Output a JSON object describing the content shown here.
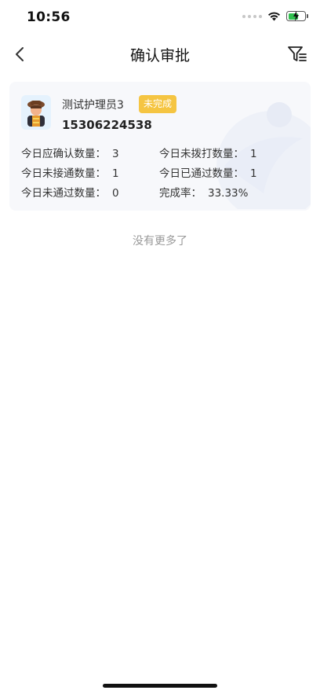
{
  "status_bar": {
    "time": "10:56"
  },
  "nav": {
    "title": "确认审批"
  },
  "card": {
    "name": "测试护理员3",
    "status": "未完成",
    "phone": "15306224538",
    "stats": [
      {
        "label": "今日应确认数量：",
        "value": "3"
      },
      {
        "label": "今日未拨打数量：",
        "value": "1"
      },
      {
        "label": "今日未接通数量：",
        "value": "1"
      },
      {
        "label": "今日已通过数量：",
        "value": "1"
      },
      {
        "label": "今日未通过数量：",
        "value": "0"
      },
      {
        "label": "完成率：",
        "value": "33.33%"
      }
    ]
  },
  "footer": {
    "no_more_text": "没有更多了"
  },
  "colors": {
    "badge": "#f5c542",
    "battery": "#30c04f",
    "card_bg": "#f7f8fb"
  },
  "icons": [
    "wifi-icon",
    "battery-icon",
    "back-arrow-icon",
    "filter-icon",
    "avatar-icon"
  ]
}
